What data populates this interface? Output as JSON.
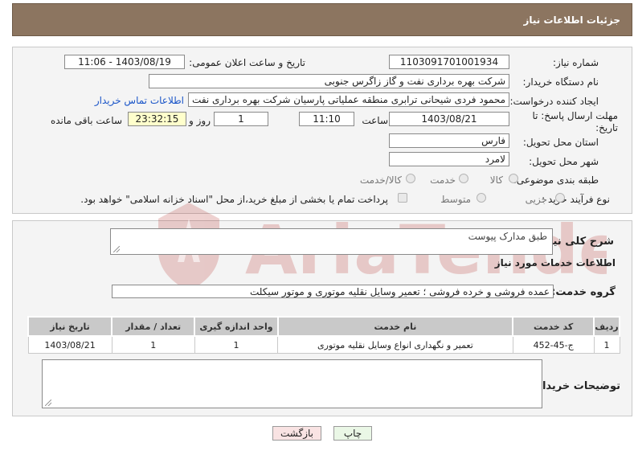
{
  "header": {
    "title": "جزئیات اطلاعات نیاز"
  },
  "form": {
    "need_number_label": "شماره نیاز:",
    "need_number": "1103091701001934",
    "announce_label": "تاریخ و ساعت اعلان عمومی:",
    "announce_value": "1403/08/19 - 11:06",
    "buyer_org_label": "نام دستگاه خریدار:",
    "buyer_org": "شرکت بهره برداری نفت و گاز زاگرس جنوبی",
    "requester_label": "ایجاد کننده درخواست:",
    "requester": "محمود فردی شیحانی ترابری منطقه عملیاتی پارسیان شرکت بهره برداری نفت و",
    "contact_link": "اطلاعات تماس خریدار",
    "deadline_label": "مهلت ارسال پاسخ: تا تاریخ:",
    "deadline_date": "1403/08/21",
    "time_label": "ساعت",
    "deadline_time": "11:10",
    "days_value": "1",
    "days_label": "روز و",
    "remaining_time": "23:32:15",
    "remaining_label": "ساعت باقی مانده",
    "province_label": "استان محل تحویل:",
    "province": "فارس",
    "city_label": "شهر محل تحویل:",
    "city": "لامرد",
    "category_label": "طبقه بندی موضوعی:",
    "category_options": [
      "کالا",
      "خدمت",
      "کالا/خدمت"
    ],
    "process_label": "نوع فرآیند خرید :",
    "process_options": [
      "جزیی",
      "متوسط"
    ],
    "payment_note": "پرداخت تمام یا بخشی از مبلغ خرید،از محل \"اسناد خزانه اسلامی\" خواهد بود."
  },
  "description": {
    "label": "شرح کلی نیاز:",
    "value": "طبق مدارک پیوست"
  },
  "services": {
    "section_title": "اطلاعات خدمات مورد نیاز",
    "group_label": "گروه خدمت:",
    "group_value": "عمده فروشی و خرده فروشی ؛ تعمیر وسایل نقلیه موتوری و موتور سیکلت",
    "columns": [
      "ردیف",
      "کد خدمت",
      "نام خدمت",
      "واحد اندازه گیری",
      "تعداد / مقدار",
      "تاریخ نیاز"
    ],
    "rows": [
      {
        "row": "1",
        "code": "ج-45-452",
        "name": "تعمیر و نگهداری انواع وسایل نقلیه موتوری",
        "unit": "1",
        "qty": "1",
        "date": "1403/08/21"
      }
    ]
  },
  "buyer_notes": {
    "label": "توضیحات خریدار:",
    "value": ""
  },
  "actions": {
    "print": "چاپ",
    "back": "بازگشت"
  },
  "watermark": {
    "text": "AriaTender.neT"
  }
}
